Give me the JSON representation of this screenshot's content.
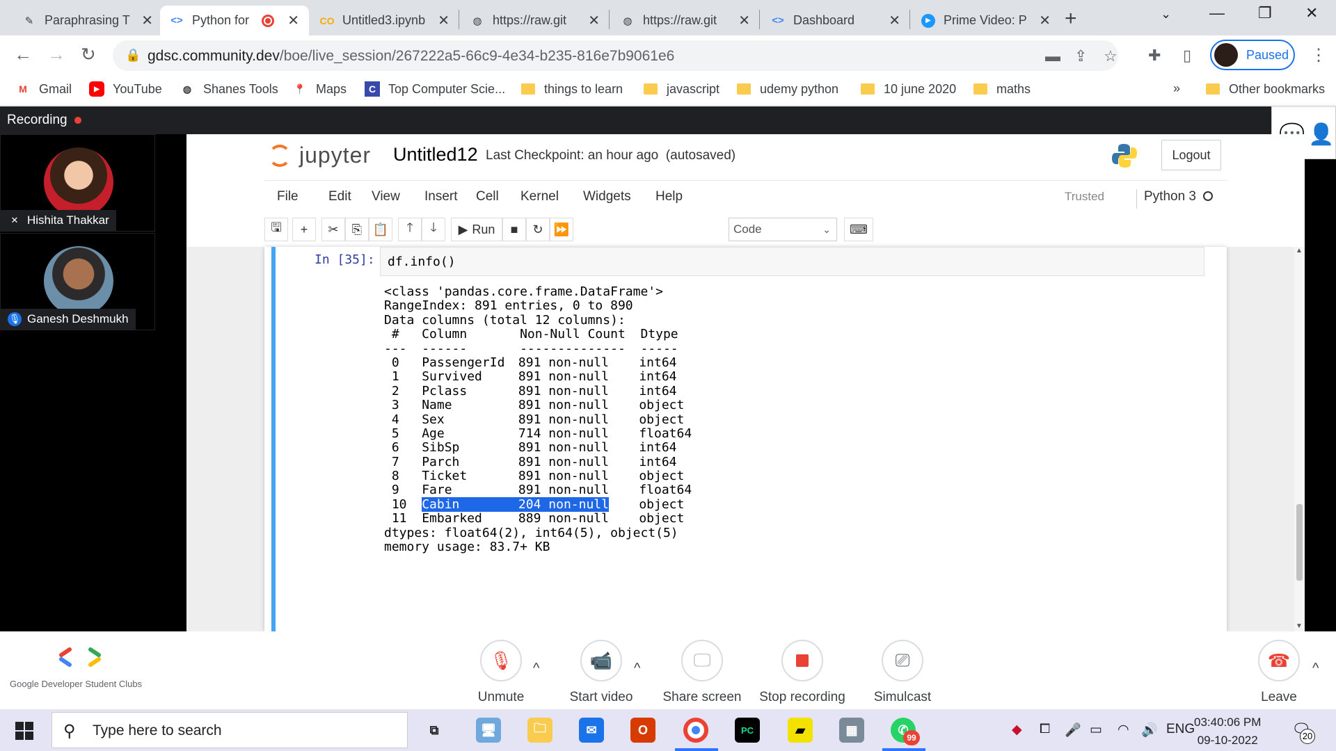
{
  "browser": {
    "tabs": [
      {
        "title": "Paraphrasing T",
        "icon": "quill-icon"
      },
      {
        "title": "Python for",
        "icon": "gdsc-icon",
        "recording": true
      },
      {
        "title": "Untitled3.ipynb",
        "icon": "colab-icon"
      },
      {
        "title": "https://raw.git",
        "icon": "globe-icon"
      },
      {
        "title": "https://raw.git",
        "icon": "globe-icon"
      },
      {
        "title": "Dashboard",
        "icon": "gdsc-icon"
      },
      {
        "title": "Prime Video: P",
        "icon": "prime-video-icon"
      }
    ],
    "url_host": "gdsc.community.dev",
    "url_path": "/boe/live_session/267222a5-66c9-4e34-b235-816e7b9061e6",
    "profile_status": "Paused",
    "bookmarks": [
      "Gmail",
      "YouTube",
      "Shanes Tools",
      "Maps",
      "Top Computer Scie...",
      "things to learn",
      "javascript",
      "udemy python",
      "10 june 2020",
      "maths"
    ],
    "overflow": "»",
    "other_bookmarks": "Other bookmarks"
  },
  "meeting": {
    "recording_label": "Recording",
    "participants": [
      {
        "name": "Hishita Thakkar"
      },
      {
        "name": "Ganesh Deshmukh"
      }
    ],
    "controls": {
      "unmute": "Unmute",
      "start_video": "Start video",
      "share_screen": "Share screen",
      "stop_recording": "Stop recording",
      "simulcast": "Simulcast",
      "leave": "Leave"
    },
    "org_name": "Google Developer Student Clubs"
  },
  "jupyter": {
    "logo_text": "jupyter",
    "notebook_title": "Untitled12",
    "checkpoint": "Last Checkpoint: an hour ago",
    "autosaved": "(autosaved)",
    "logout": "Logout",
    "menu": [
      "File",
      "Edit",
      "View",
      "Insert",
      "Cell",
      "Kernel",
      "Widgets",
      "Help"
    ],
    "trusted": "Trusted",
    "kernel": "Python 3",
    "run_label": "Run",
    "cell_type": "Code",
    "prompt": "In [35]:",
    "code": "df.info()",
    "output_header": [
      "<class 'pandas.core.frame.DataFrame'>",
      "RangeIndex: 891 entries, 0 to 890",
      "Data columns (total 12 columns):",
      " #   Column       Non-Null Count  Dtype  ",
      "---  ------       --------------  -----  "
    ],
    "rows": [
      {
        "idx": " 0 ",
        "column": "PassengerId",
        "count": "891 non-null",
        "dtype": "int64"
      },
      {
        "idx": " 1 ",
        "column": "Survived",
        "count": "891 non-null",
        "dtype": "int64"
      },
      {
        "idx": " 2 ",
        "column": "Pclass",
        "count": "891 non-null",
        "dtype": "int64"
      },
      {
        "idx": " 3 ",
        "column": "Name",
        "count": "891 non-null",
        "dtype": "object"
      },
      {
        "idx": " 4 ",
        "column": "Sex",
        "count": "891 non-null",
        "dtype": "object"
      },
      {
        "idx": " 5 ",
        "column": "Age",
        "count": "714 non-null",
        "dtype": "float64"
      },
      {
        "idx": " 6 ",
        "column": "SibSp",
        "count": "891 non-null",
        "dtype": "int64"
      },
      {
        "idx": " 7 ",
        "column": "Parch",
        "count": "891 non-null",
        "dtype": "int64"
      },
      {
        "idx": " 8 ",
        "column": "Ticket",
        "count": "891 non-null",
        "dtype": "object"
      },
      {
        "idx": " 9 ",
        "column": "Fare",
        "count": "891 non-null",
        "dtype": "float64"
      },
      {
        "idx": " 10",
        "column": "Cabin",
        "count": "204 non-null",
        "dtype": "object",
        "selected": true
      },
      {
        "idx": " 11",
        "column": "Embarked",
        "count": "889 non-null",
        "dtype": "object"
      }
    ],
    "output_footer": [
      "dtypes: float64(2), int64(5), object(5)",
      "memory usage: 83.7+ KB"
    ]
  },
  "taskbar": {
    "search_placeholder": "Type here to search",
    "whatsapp_badge": "99",
    "language": "ENG",
    "time": "03:40:06 PM",
    "date": "09-10-2022",
    "notifications": "20"
  },
  "colors": {
    "selection": "#1e67e6",
    "cell_border": "#42a5f5",
    "recording_red": "#ea4335",
    "chrome_blue": "#1a73e8"
  }
}
